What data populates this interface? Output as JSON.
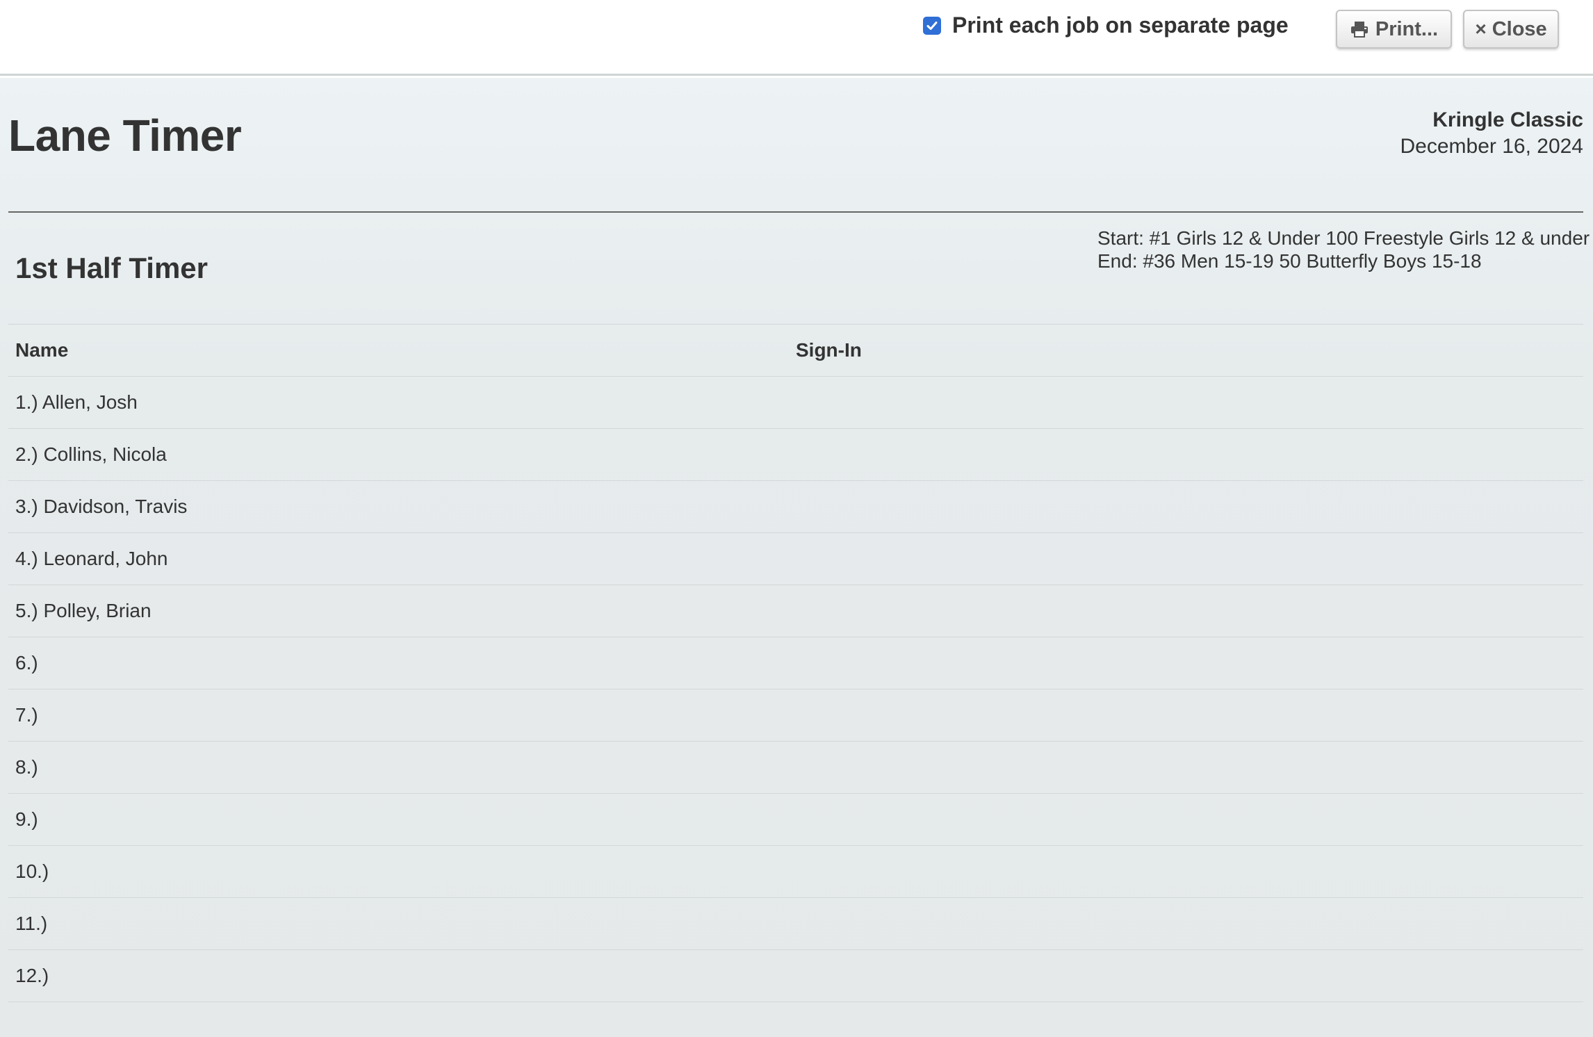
{
  "toolbar": {
    "separate_page_label": "Print each job on separate page",
    "separate_page_checked": true,
    "print_label": "Print...",
    "close_label": "Close",
    "close_symbol": "×",
    "print_icon": "printer-icon",
    "checkbox_color": "#2f6fd6"
  },
  "header": {
    "title": "Lane Timer",
    "meet_name": "Kringle Classic",
    "meet_date": "December 16, 2024"
  },
  "job": {
    "title": "1st Half Timer",
    "start": "Start: #1 Girls 12 & Under 100 Freestyle Girls 12 & under",
    "end": "End: #36 Men 15-19 50 Butterfly Boys 15-18"
  },
  "table": {
    "columns": [
      "Name",
      "Sign-In"
    ],
    "rows": [
      {
        "name": "1.) Allen, Josh",
        "sign_in": ""
      },
      {
        "name": "2.) Collins, Nicola",
        "sign_in": ""
      },
      {
        "name": "3.) Davidson, Travis",
        "sign_in": ""
      },
      {
        "name": "4.) Leonard, John",
        "sign_in": ""
      },
      {
        "name": "5.) Polley, Brian",
        "sign_in": ""
      },
      {
        "name": "6.)",
        "sign_in": ""
      },
      {
        "name": "7.)",
        "sign_in": ""
      },
      {
        "name": "8.)",
        "sign_in": ""
      },
      {
        "name": "9.)",
        "sign_in": ""
      },
      {
        "name": "10.)",
        "sign_in": ""
      },
      {
        "name": "11.)",
        "sign_in": ""
      },
      {
        "name": "12.)",
        "sign_in": ""
      }
    ]
  }
}
